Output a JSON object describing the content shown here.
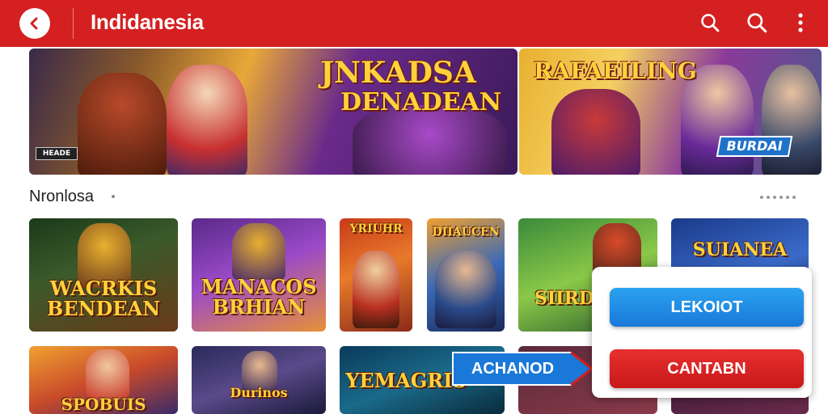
{
  "header": {
    "title": "Indidanesia",
    "back_icon": "chevron-left-icon",
    "search_icon_1": "search-icon",
    "search_icon_2": "search-icon",
    "menu_icon": "more-vertical-icon"
  },
  "banners": [
    {
      "title_line1": "JNKADSA",
      "title_line2": "DENADEAN",
      "logo_text": "HEADE"
    },
    {
      "title": "RAFAEILING",
      "badge": "BURDAI"
    }
  ],
  "section": {
    "title": "Nronlosa"
  },
  "cards_row1": [
    {
      "title": "WACRKIS BENDEAN"
    },
    {
      "title": "MANACOS BRHIAN"
    },
    {
      "title": "YRIUHR"
    },
    {
      "title": "DIIAUCEN"
    },
    {
      "title": "SIIRD ERI"
    },
    {
      "title": "SUIANEA"
    }
  ],
  "cards_row2": [
    {
      "title": "SPOBUIS"
    },
    {
      "title": "Durinos"
    },
    {
      "title": "YEMAGRIS"
    }
  ],
  "actions": {
    "primary_label": "LEKOIOT",
    "secondary_label": "CANTABN",
    "arrow_label": "ACHANOD"
  },
  "colors": {
    "header": "#d42020",
    "primary_button": "#1a78d8",
    "secondary_button": "#c81818"
  }
}
